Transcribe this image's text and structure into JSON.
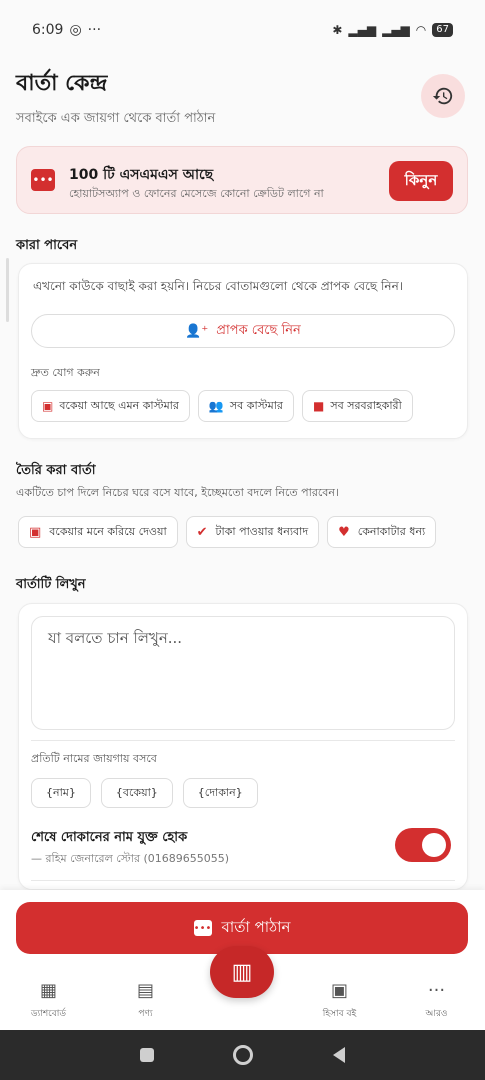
{
  "status_bar": {
    "time": "6:09",
    "battery": "67"
  },
  "header": {
    "title": "বার্তা কেন্দ্র",
    "subtitle": "সবাইকে এক জায়গা থেকে বার্তা পাঠান"
  },
  "credit": {
    "title": "100 টি এসএমএস আছে",
    "subtitle": "হোয়াটসঅ্যাপ ও ফোনের মেসেজে কোনো ক্রেডিট লাগে না",
    "buy_label": "কিনুন"
  },
  "recipients": {
    "section_label": "কারা পাবেন",
    "empty_text": "এখনো কাউকে বাছাই করা হয়নি। নিচের বোতামগুলো থেকে প্রাপক বেছে নিন।",
    "pick_label": "প্রাপক বেছে নিন",
    "quick_label": "দ্রুত যোগ করুন",
    "quick_items": [
      {
        "label": "বকেয়া আছে এমন কাস্টমার"
      },
      {
        "label": "সব কাস্টমার"
      },
      {
        "label": "সব সরবরাহকারী"
      }
    ]
  },
  "templates": {
    "section_label": "তৈরি করা বার্তা",
    "description": "একটিতে চাপ দিলে নিচের ঘরে বসে যাবে, ইচ্ছেমতো বদলে নিতে পারবেন।",
    "items": [
      {
        "label": "বকেয়ার মনে করিয়ে দেওয়া"
      },
      {
        "label": "টাকা পাওয়ার ধন্যবাদ"
      },
      {
        "label": "কেনাকাটার ধন্য"
      }
    ]
  },
  "compose": {
    "section_label": "বার্তাটি লিখুন",
    "placeholder": "যা বলতে চান লিখুন...",
    "placeholder_label": "প্রতিটি নামের জায়গায় বসবে",
    "placeholders": [
      "{নাম}",
      "{বকেয়া}",
      "{দোকান}"
    ],
    "signature_title": "শেষে দোকানের নাম যুক্ত হোক",
    "signature_sub": "— রহিম জেনারেল স্টোর (01689655055)"
  },
  "send_label": "বার্তা পাঠান",
  "nav": [
    {
      "label": "ড্যাশবোর্ড"
    },
    {
      "label": "পণ্য"
    },
    {
      "label": "হিসাব বই"
    },
    {
      "label": "আরও"
    }
  ],
  "colors": {
    "accent": "#d32f2f",
    "accent_light": "#fbeaea"
  }
}
